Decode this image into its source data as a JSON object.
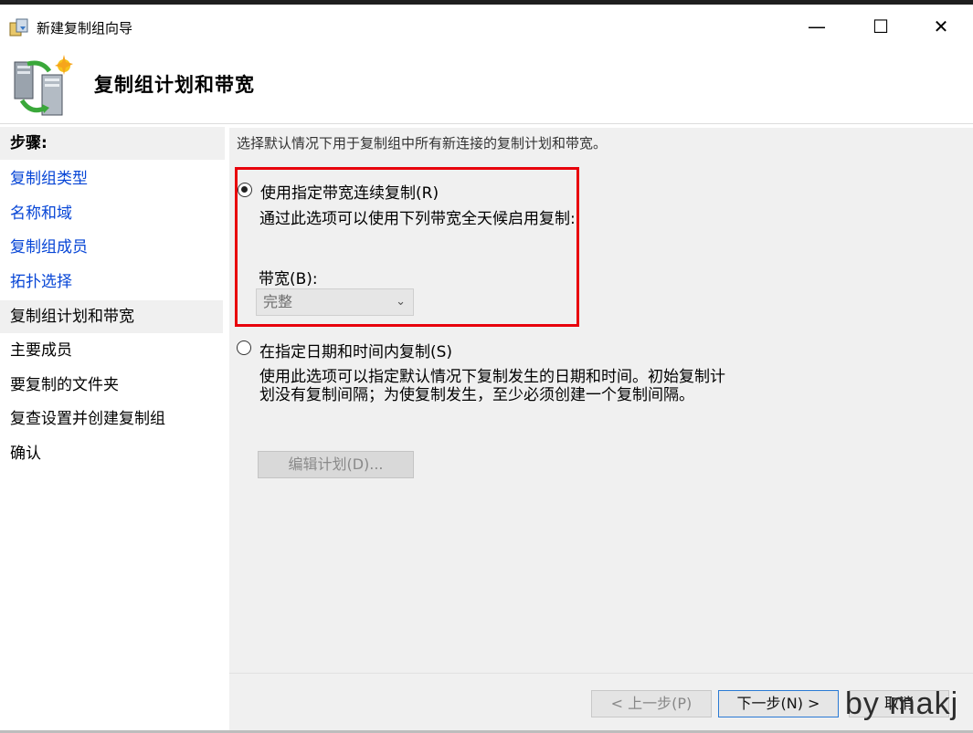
{
  "window": {
    "title": "新建复制组向导",
    "minimize_glyph": "—",
    "maximize_glyph": "☐",
    "close_glyph": "✕"
  },
  "header": {
    "title": "复制组计划和带宽"
  },
  "sidebar": {
    "heading": "步骤:",
    "items": [
      {
        "label": "复制组类型",
        "state": "link"
      },
      {
        "label": "名称和域",
        "state": "link"
      },
      {
        "label": "复制组成员",
        "state": "link"
      },
      {
        "label": "拓扑选择",
        "state": "link"
      },
      {
        "label": "复制组计划和带宽",
        "state": "current"
      },
      {
        "label": "主要成员",
        "state": "plain"
      },
      {
        "label": "要复制的文件夹",
        "state": "plain"
      },
      {
        "label": "复查设置并创建复制组",
        "state": "plain"
      },
      {
        "label": "确认",
        "state": "plain"
      }
    ]
  },
  "main": {
    "description": "选择默认情况下用于复制组中所有新连接的复制计划和带宽。",
    "option1": {
      "label": "使用指定带宽连续复制(R)",
      "description": "通过此选项可以使用下列带宽全天候启用复制:",
      "checked": true
    },
    "bandwidth": {
      "label": "带宽(B):",
      "value": "完整"
    },
    "option2": {
      "label": "在指定日期和时间内复制(S)",
      "description_line1": "使用此选项可以指定默认情况下复制发生的日期和时间。初始复制计",
      "description_line2": "划没有复制间隔；为使复制发生，至少必须创建一个复制间隔。",
      "checked": false
    },
    "edit_schedule_button": "编辑计划(D)..."
  },
  "footer": {
    "prev_button": "< 上一步(P)",
    "next_button": "下一步(N) >",
    "cancel_button": "取消"
  },
  "watermark": "by makj",
  "colors": {
    "link": "#0645d6",
    "highlight": "#e8000b",
    "panel": "#f0f0f0"
  }
}
